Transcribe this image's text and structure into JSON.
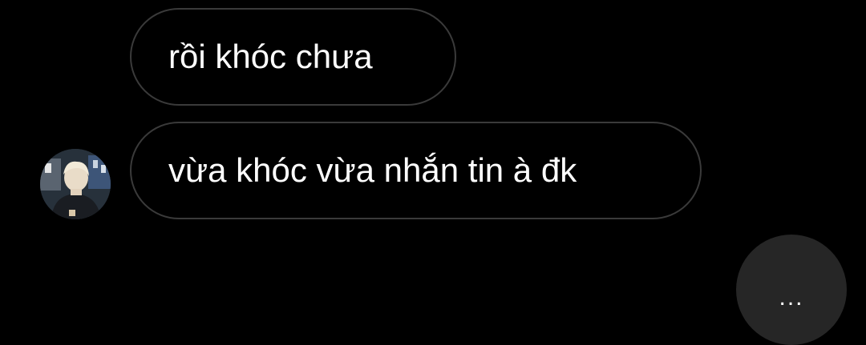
{
  "messages": [
    {
      "text": "rồi khóc chưa"
    },
    {
      "text": "vừa khóc vừa nhắn tin à đk"
    }
  ],
  "typing_indicator": {
    "dots": "..."
  },
  "colors": {
    "background": "#000000",
    "bubble_border": "#3a3a3a",
    "text": "#ffffff",
    "typing_bg": "#262626"
  }
}
